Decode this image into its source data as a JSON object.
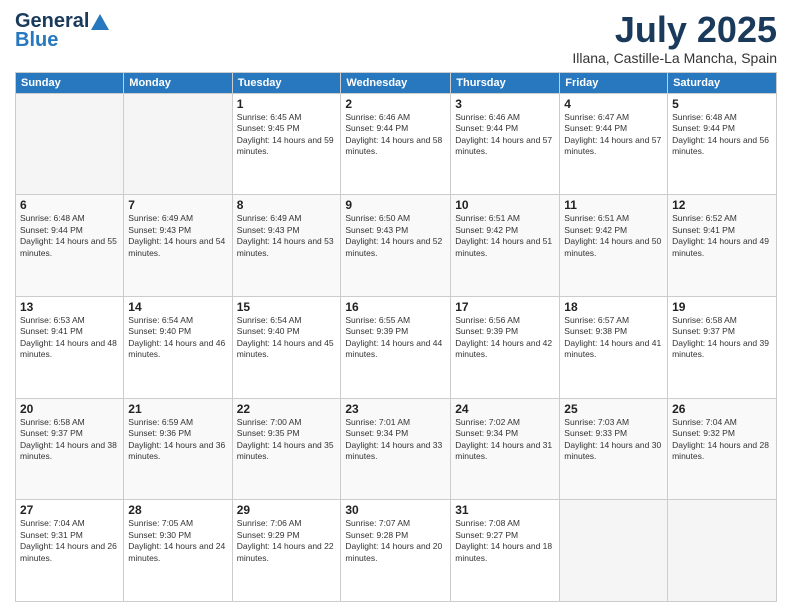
{
  "logo": {
    "line1": "General",
    "line2": "Blue"
  },
  "title": "July 2025",
  "location": "Illana, Castille-La Mancha, Spain",
  "days_of_week": [
    "Sunday",
    "Monday",
    "Tuesday",
    "Wednesday",
    "Thursday",
    "Friday",
    "Saturday"
  ],
  "weeks": [
    [
      {
        "num": "",
        "info": ""
      },
      {
        "num": "",
        "info": ""
      },
      {
        "num": "1",
        "info": "Sunrise: 6:45 AM\nSunset: 9:45 PM\nDaylight: 14 hours and 59 minutes."
      },
      {
        "num": "2",
        "info": "Sunrise: 6:46 AM\nSunset: 9:44 PM\nDaylight: 14 hours and 58 minutes."
      },
      {
        "num": "3",
        "info": "Sunrise: 6:46 AM\nSunset: 9:44 PM\nDaylight: 14 hours and 57 minutes."
      },
      {
        "num": "4",
        "info": "Sunrise: 6:47 AM\nSunset: 9:44 PM\nDaylight: 14 hours and 57 minutes."
      },
      {
        "num": "5",
        "info": "Sunrise: 6:48 AM\nSunset: 9:44 PM\nDaylight: 14 hours and 56 minutes."
      }
    ],
    [
      {
        "num": "6",
        "info": "Sunrise: 6:48 AM\nSunset: 9:44 PM\nDaylight: 14 hours and 55 minutes."
      },
      {
        "num": "7",
        "info": "Sunrise: 6:49 AM\nSunset: 9:43 PM\nDaylight: 14 hours and 54 minutes."
      },
      {
        "num": "8",
        "info": "Sunrise: 6:49 AM\nSunset: 9:43 PM\nDaylight: 14 hours and 53 minutes."
      },
      {
        "num": "9",
        "info": "Sunrise: 6:50 AM\nSunset: 9:43 PM\nDaylight: 14 hours and 52 minutes."
      },
      {
        "num": "10",
        "info": "Sunrise: 6:51 AM\nSunset: 9:42 PM\nDaylight: 14 hours and 51 minutes."
      },
      {
        "num": "11",
        "info": "Sunrise: 6:51 AM\nSunset: 9:42 PM\nDaylight: 14 hours and 50 minutes."
      },
      {
        "num": "12",
        "info": "Sunrise: 6:52 AM\nSunset: 9:41 PM\nDaylight: 14 hours and 49 minutes."
      }
    ],
    [
      {
        "num": "13",
        "info": "Sunrise: 6:53 AM\nSunset: 9:41 PM\nDaylight: 14 hours and 48 minutes."
      },
      {
        "num": "14",
        "info": "Sunrise: 6:54 AM\nSunset: 9:40 PM\nDaylight: 14 hours and 46 minutes."
      },
      {
        "num": "15",
        "info": "Sunrise: 6:54 AM\nSunset: 9:40 PM\nDaylight: 14 hours and 45 minutes."
      },
      {
        "num": "16",
        "info": "Sunrise: 6:55 AM\nSunset: 9:39 PM\nDaylight: 14 hours and 44 minutes."
      },
      {
        "num": "17",
        "info": "Sunrise: 6:56 AM\nSunset: 9:39 PM\nDaylight: 14 hours and 42 minutes."
      },
      {
        "num": "18",
        "info": "Sunrise: 6:57 AM\nSunset: 9:38 PM\nDaylight: 14 hours and 41 minutes."
      },
      {
        "num": "19",
        "info": "Sunrise: 6:58 AM\nSunset: 9:37 PM\nDaylight: 14 hours and 39 minutes."
      }
    ],
    [
      {
        "num": "20",
        "info": "Sunrise: 6:58 AM\nSunset: 9:37 PM\nDaylight: 14 hours and 38 minutes."
      },
      {
        "num": "21",
        "info": "Sunrise: 6:59 AM\nSunset: 9:36 PM\nDaylight: 14 hours and 36 minutes."
      },
      {
        "num": "22",
        "info": "Sunrise: 7:00 AM\nSunset: 9:35 PM\nDaylight: 14 hours and 35 minutes."
      },
      {
        "num": "23",
        "info": "Sunrise: 7:01 AM\nSunset: 9:34 PM\nDaylight: 14 hours and 33 minutes."
      },
      {
        "num": "24",
        "info": "Sunrise: 7:02 AM\nSunset: 9:34 PM\nDaylight: 14 hours and 31 minutes."
      },
      {
        "num": "25",
        "info": "Sunrise: 7:03 AM\nSunset: 9:33 PM\nDaylight: 14 hours and 30 minutes."
      },
      {
        "num": "26",
        "info": "Sunrise: 7:04 AM\nSunset: 9:32 PM\nDaylight: 14 hours and 28 minutes."
      }
    ],
    [
      {
        "num": "27",
        "info": "Sunrise: 7:04 AM\nSunset: 9:31 PM\nDaylight: 14 hours and 26 minutes."
      },
      {
        "num": "28",
        "info": "Sunrise: 7:05 AM\nSunset: 9:30 PM\nDaylight: 14 hours and 24 minutes."
      },
      {
        "num": "29",
        "info": "Sunrise: 7:06 AM\nSunset: 9:29 PM\nDaylight: 14 hours and 22 minutes."
      },
      {
        "num": "30",
        "info": "Sunrise: 7:07 AM\nSunset: 9:28 PM\nDaylight: 14 hours and 20 minutes."
      },
      {
        "num": "31",
        "info": "Sunrise: 7:08 AM\nSunset: 9:27 PM\nDaylight: 14 hours and 18 minutes."
      },
      {
        "num": "",
        "info": ""
      },
      {
        "num": "",
        "info": ""
      }
    ]
  ]
}
